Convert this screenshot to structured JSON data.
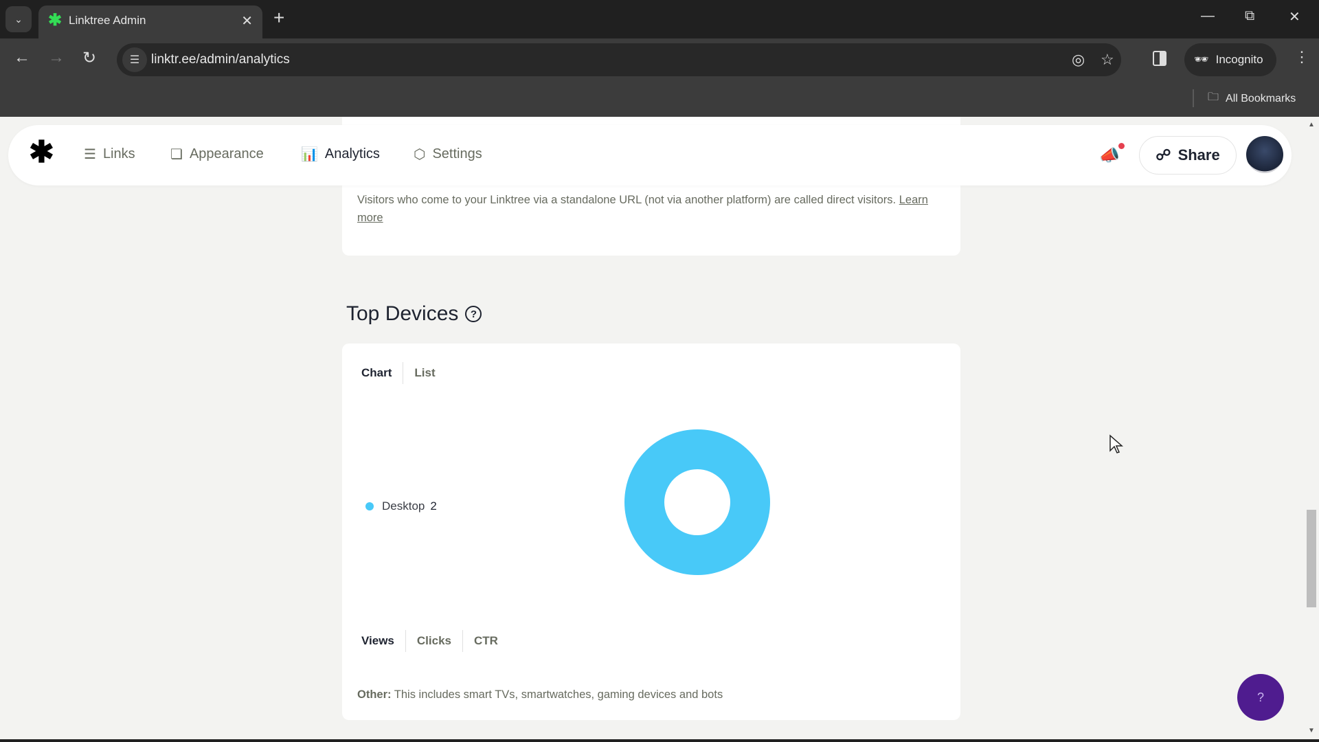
{
  "browser": {
    "tab_title": "Linktree Admin",
    "url": "linktr.ee/admin/analytics",
    "incognito_label": "Incognito",
    "bookmarks_label": "All Bookmarks"
  },
  "nav": {
    "items": [
      {
        "label": "Links",
        "icon": "links-icon",
        "active": false
      },
      {
        "label": "Appearance",
        "icon": "appearance-icon",
        "active": false
      },
      {
        "label": "Analytics",
        "icon": "analytics-icon",
        "active": true
      },
      {
        "label": "Settings",
        "icon": "settings-icon",
        "active": false
      }
    ],
    "share_label": "Share"
  },
  "direct_visitors": {
    "description": "Visitors who come to your Linktree via a standalone URL (not via another platform) are called direct visitors.",
    "learn_more": "Learn more"
  },
  "top_devices": {
    "title": "Top Devices",
    "view_tabs": [
      "Chart",
      "List"
    ],
    "active_view": "Chart",
    "metric_tabs": [
      "Views",
      "Clicks",
      "CTR"
    ],
    "active_metric": "Views",
    "footnote_label": "Other:",
    "footnote_text": "This includes smart TVs, smartwatches, gaming devices and bots"
  },
  "chart_data": {
    "type": "pie",
    "title": "Top Devices",
    "categories": [
      "Desktop"
    ],
    "values": [
      2
    ],
    "colors": [
      "#48c9f8"
    ],
    "donut": true,
    "legend": "left"
  },
  "help_fab_label": "?"
}
